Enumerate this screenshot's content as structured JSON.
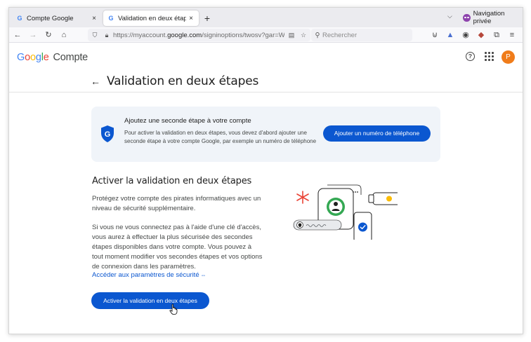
{
  "browser": {
    "tabs": [
      {
        "label": "Compte Google",
        "active": false,
        "favicon": "google-g-icon"
      },
      {
        "label": "Validation en deux étapes",
        "active": true,
        "favicon": "google-g-icon"
      }
    ],
    "close_glyph": "×",
    "new_tab_glyph": "+",
    "list_all_glyph": "⌵",
    "private_label": "Navigation privée",
    "url_prefix": "https://myaccount.",
    "url_domain": "google.com",
    "url_suffix": "/signinoptions/twosv?gar=W:",
    "search_placeholder": "Rechercher",
    "icons": {
      "back": "←",
      "forward": "→",
      "reload": "↻",
      "home": "⌂",
      "reader": "▤",
      "bookmark": "☆",
      "search": "⚲",
      "pocket": "⊍",
      "extensions": "⧉",
      "account": "◉",
      "menu": "≡"
    }
  },
  "header": {
    "logo_letters": [
      "G",
      "o",
      "o",
      "g",
      "l",
      "e"
    ],
    "product": "Compte",
    "help_glyph": "?",
    "avatar_letter": "P"
  },
  "page": {
    "back_glyph": "←",
    "title": "Validation en deux étapes"
  },
  "card": {
    "title": "Ajoutez une seconde étape à votre compte",
    "description": "Pour activer la validation en deux étapes, vous devez d'abord ajouter une seconde étape à votre compte Google, par exemple un numéro de téléphone",
    "button": "Ajouter un numéro de téléphone"
  },
  "section": {
    "title": "Activer la validation en deux étapes",
    "paragraph1": "Protégez votre compte des pirates informatiques avec un niveau de sécurité supplémentaire.",
    "paragraph2": "Si vous ne vous connectez pas à l'aide d'une clé d'accès, vous aurez à effectuer la plus sécurisée des secondes étapes disponibles dans votre compte. Vous pouvez à tout moment modifier vos secondes étapes et vos options de connexion dans les paramètres.",
    "link": "Accéder aux paramètres de sécurité",
    "link_icon": "⇔",
    "button": "Activer la validation en deux étapes"
  },
  "colors": {
    "primary": "#0b57d0",
    "card_bg": "#f0f4f9",
    "avatar": "#f07c1a",
    "accent_red": "#ea4335",
    "accent_green": "#34a853",
    "accent_yellow": "#fbbc05"
  }
}
